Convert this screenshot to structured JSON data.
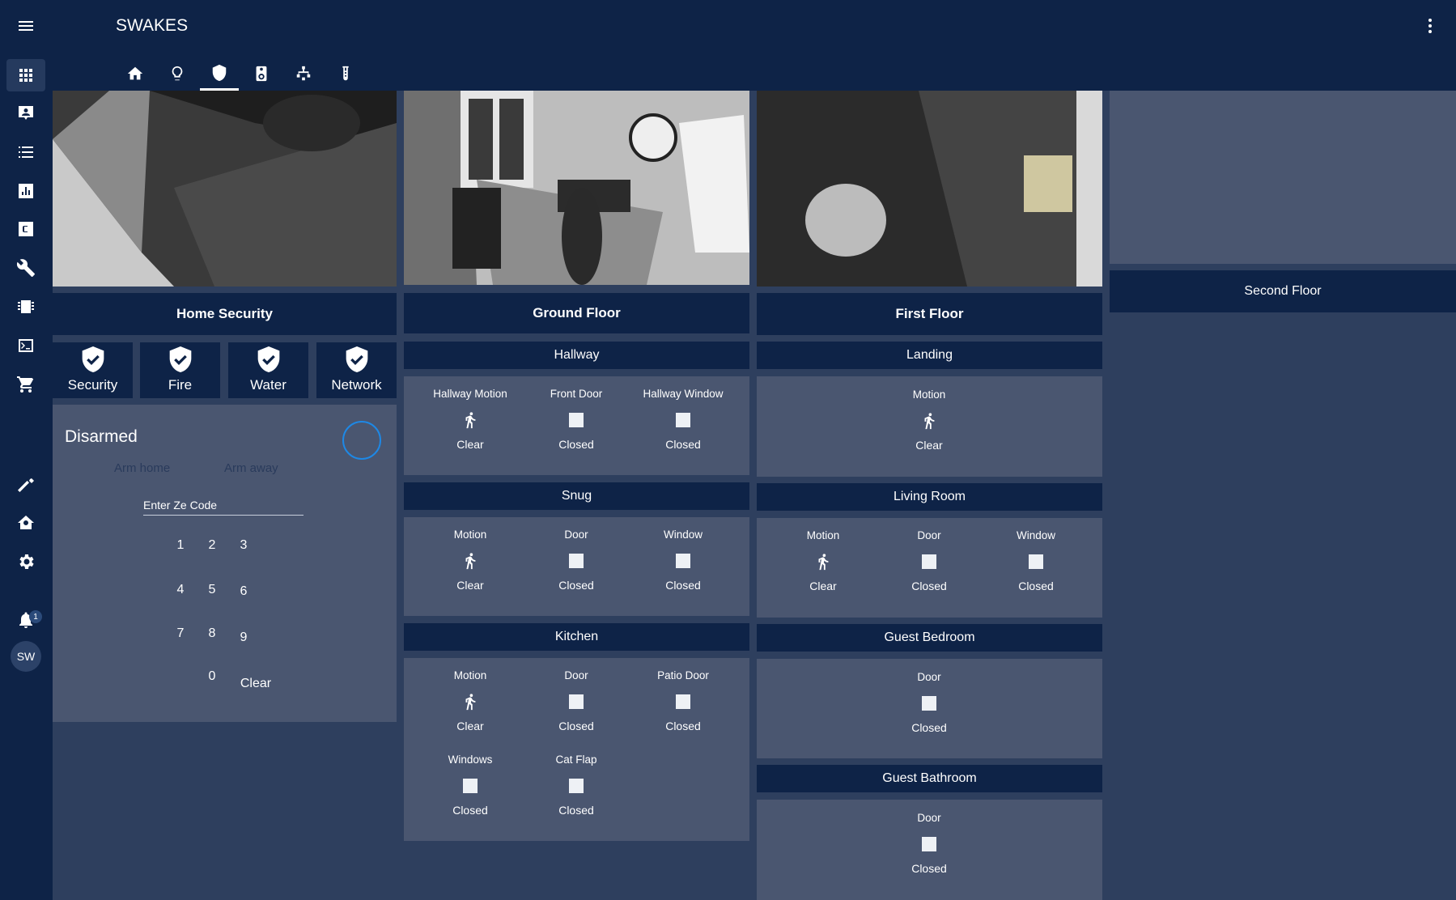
{
  "app": {
    "title": "SWAKES"
  },
  "sidebar": {
    "items": [
      {
        "icon": "menu-icon"
      },
      {
        "icon": "dashboard-grid-icon"
      },
      {
        "icon": "account-box-icon"
      },
      {
        "icon": "list-icon"
      },
      {
        "icon": "chart-icon"
      },
      {
        "icon": "c-box-icon"
      },
      {
        "icon": "wrench-icon"
      },
      {
        "icon": "chip-icon"
      },
      {
        "icon": "terminal-icon"
      },
      {
        "icon": "cart-icon"
      },
      {
        "icon": "hammer-icon"
      },
      {
        "icon": "home-gear-icon"
      },
      {
        "icon": "settings-icon"
      }
    ],
    "notification_count": "1",
    "user_initials": "SW"
  },
  "tabs": [
    {
      "icon": "home-icon"
    },
    {
      "icon": "lightbulb-icon"
    },
    {
      "icon": "shield-icon",
      "active": true
    },
    {
      "icon": "speaker-icon"
    },
    {
      "icon": "network-icon"
    },
    {
      "icon": "test-tube-icon"
    }
  ],
  "columns": {
    "home_security": {
      "title": "Home Security",
      "status_buttons": [
        {
          "label": "Security"
        },
        {
          "label": "Fire"
        },
        {
          "label": "Water"
        },
        {
          "label": "Network"
        }
      ],
      "alarm": {
        "state": "Disarmed",
        "arm_home": "Arm home",
        "arm_away": "Arm away",
        "code_label": "Enter Ze Code",
        "keys": [
          "1",
          "2",
          "3",
          "4",
          "5",
          "6",
          "7",
          "8",
          "9",
          "0"
        ],
        "clear": "Clear"
      }
    },
    "ground_floor": {
      "title": "Ground Floor",
      "rooms": [
        {
          "name": "Hallway",
          "sensors": [
            {
              "label": "Hallway Motion",
              "state": "Clear",
              "type": "motion"
            },
            {
              "label": "Front Door",
              "state": "Closed",
              "type": "contact"
            },
            {
              "label": "Hallway Window",
              "state": "Closed",
              "type": "contact"
            }
          ]
        },
        {
          "name": "Snug",
          "sensors": [
            {
              "label": "Motion",
              "state": "Clear",
              "type": "motion"
            },
            {
              "label": "Door",
              "state": "Closed",
              "type": "contact"
            },
            {
              "label": "Window",
              "state": "Closed",
              "type": "contact"
            }
          ]
        },
        {
          "name": "Kitchen",
          "sensors": [
            {
              "label": "Motion",
              "state": "Clear",
              "type": "motion"
            },
            {
              "label": "Door",
              "state": "Closed",
              "type": "contact"
            },
            {
              "label": "Patio Door",
              "state": "Closed",
              "type": "contact"
            },
            {
              "label": "Windows",
              "state": "Closed",
              "type": "contact"
            },
            {
              "label": "Cat Flap",
              "state": "Closed",
              "type": "contact"
            }
          ]
        }
      ]
    },
    "first_floor": {
      "title": "First Floor",
      "rooms": [
        {
          "name": "Landing",
          "sensors": [
            {
              "label": "Motion",
              "state": "Clear",
              "type": "motion"
            }
          ]
        },
        {
          "name": "Living Room",
          "sensors": [
            {
              "label": "Motion",
              "state": "Clear",
              "type": "motion"
            },
            {
              "label": "Door",
              "state": "Closed",
              "type": "contact"
            },
            {
              "label": "Window",
              "state": "Closed",
              "type": "contact"
            }
          ]
        },
        {
          "name": "Guest Bedroom",
          "sensors": [
            {
              "label": "Door",
              "state": "Closed",
              "type": "contact"
            }
          ]
        },
        {
          "name": "Guest Bathroom",
          "sensors": [
            {
              "label": "Door",
              "state": "Closed",
              "type": "contact"
            }
          ]
        }
      ]
    },
    "second_floor": {
      "title": "Second Floor"
    }
  },
  "colors": {
    "header": "#0e2347",
    "background": "#2e3f5e",
    "card": "#4a5670",
    "accent_ring": "#1e88e5"
  }
}
